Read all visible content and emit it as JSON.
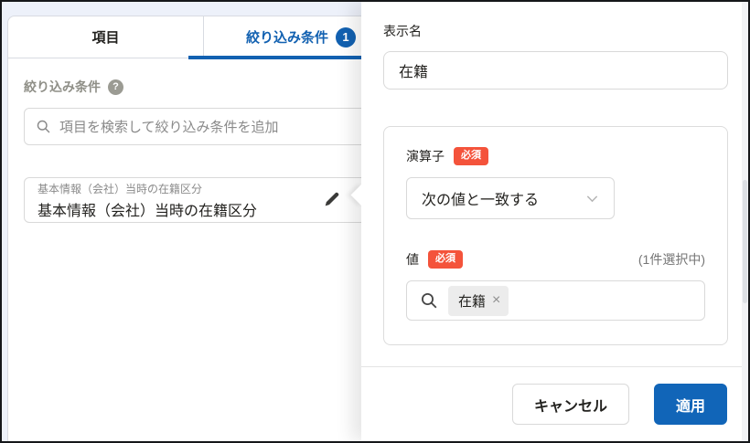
{
  "colors": {
    "accent_blue": "#1261b1",
    "apply_button_blue": "#1165b8",
    "required_red": "#f4533b",
    "page_background": "#edf1fa"
  },
  "left_panel": {
    "tabs": [
      {
        "label": "項目",
        "active": false
      },
      {
        "label": "絞り込み条件",
        "badge": "1",
        "active": true
      }
    ],
    "section_title": "絞り込み条件",
    "help_icon_glyph": "?",
    "search": {
      "placeholder": "項目を検索して絞り込み条件を追加"
    },
    "condition_item": {
      "field_label": "基本情報（会社）当時の在籍区分",
      "display_name": "基本情報（会社）当時の在籍区分"
    }
  },
  "dialog": {
    "display_name": {
      "label": "表示名",
      "value": "在籍"
    },
    "operator": {
      "label": "演算子",
      "required_badge": "必須",
      "selected_option": "次の値と一致する"
    },
    "value": {
      "label": "値",
      "required_badge": "必須",
      "selection_count": "(1件選択中)",
      "chips": [
        {
          "label": "在籍",
          "remove_glyph": "×"
        }
      ]
    },
    "footer": {
      "cancel_label": "キャンセル",
      "apply_label": "適用"
    }
  },
  "icons": {
    "search": "magnifier-icon",
    "help": "question-circle-icon",
    "edit": "pencil-icon",
    "dropdown": "chevron-down-icon",
    "chip_remove": "close-icon"
  }
}
